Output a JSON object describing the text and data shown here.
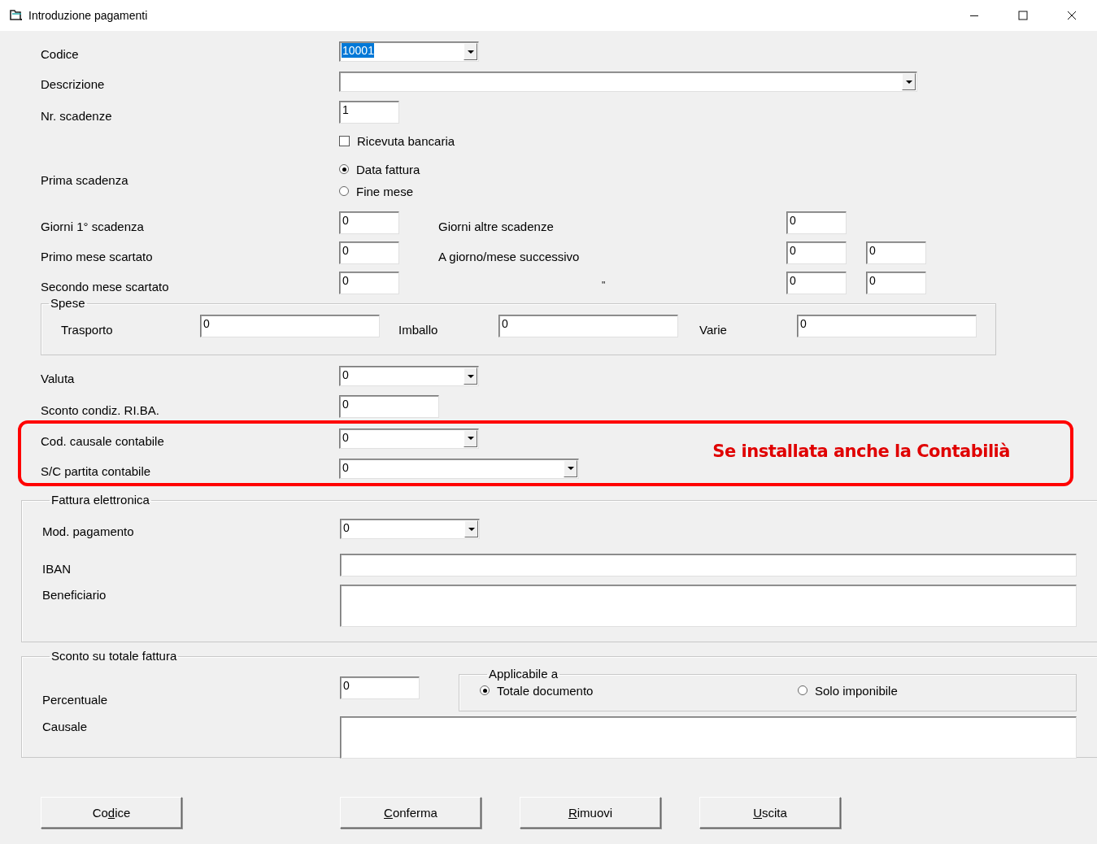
{
  "window": {
    "title": "Introduzione pagamenti"
  },
  "codice": {
    "label": "Codice",
    "value": "10001",
    "text_selected": true
  },
  "descrizione": {
    "label": "Descrizione"
  },
  "nr_scadenze": {
    "label": "Nr. scadenze",
    "value": "1"
  },
  "ricevuta_bancaria": {
    "label": "Ricevuta bancaria",
    "checked": false
  },
  "prima_scadenza": {
    "label": "Prima scadenza",
    "options": [
      {
        "label": "Data fattura",
        "selected": true
      },
      {
        "label": "Fine mese",
        "selected": false
      }
    ]
  },
  "schedule_rows": [
    {
      "label": "Giorni 1° scadenza",
      "value": "0",
      "middle": {
        "kind": "label",
        "text": "Giorni altre scadenze"
      },
      "values": [
        "0"
      ]
    },
    {
      "label": "Primo mese scartato",
      "value": "0",
      "middle": {
        "kind": "label",
        "text": "A giorno/mese successivo"
      },
      "values": [
        "0",
        "0"
      ]
    },
    {
      "label": "Secondo mese scartato",
      "value": "0",
      "middle": {
        "kind": "ditto",
        "text": "\""
      },
      "values": [
        "0",
        "0"
      ]
    }
  ],
  "spese": {
    "title": "Spese",
    "fields": [
      {
        "label": "Trasporto",
        "value": "0"
      },
      {
        "label": "Imballo",
        "value": "0"
      },
      {
        "label": "Varie",
        "value": "0"
      }
    ]
  },
  "valuta": {
    "label": "Valuta",
    "value": "0"
  },
  "sconto_riba": {
    "label": "Sconto condiz. RI.BA.",
    "value": "0"
  },
  "contabilita": {
    "note": "Se installata anche la Contabilià",
    "fields": [
      {
        "label": "Cod. causale contabile",
        "value": "0"
      },
      {
        "label": "S/C partita contabile",
        "value": "0"
      }
    ]
  },
  "fattura_elettronica": {
    "title": "Fattura elettronica",
    "mod_pagamento": {
      "label": "Mod. pagamento",
      "value": "0"
    },
    "iban": {
      "label": "IBAN"
    },
    "beneficiario": {
      "label": "Beneficiario"
    }
  },
  "sconto_totale": {
    "title": "Sconto su totale fattura",
    "percentuale": {
      "label": "Percentuale",
      "value": "0"
    },
    "applicabile": {
      "title": "Applicabile a",
      "options": [
        {
          "label": "Totale documento",
          "selected": true
        },
        {
          "label": "Solo imponibile",
          "selected": false
        }
      ]
    },
    "causale": {
      "label": "Causale"
    }
  },
  "buttons": [
    {
      "pre": "Co",
      "key": "d",
      "post": "ice"
    },
    {
      "key": "C",
      "post": "onferma"
    },
    {
      "key": "R",
      "post": "imuovi"
    },
    {
      "key": "U",
      "post": "scita"
    }
  ]
}
